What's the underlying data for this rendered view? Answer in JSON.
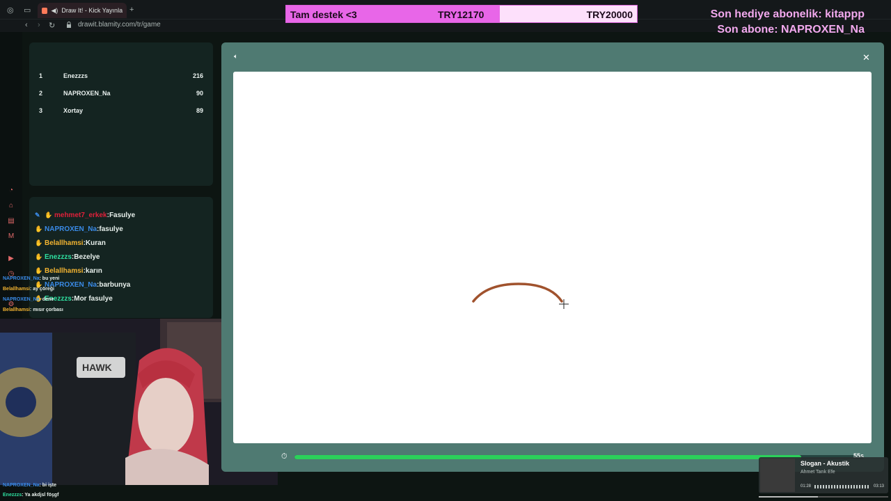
{
  "browser": {
    "tab_title": "Draw It! - Kick Yayınları",
    "url": "drawit.blamity.com/tr/game"
  },
  "leaderboard": [
    {
      "rank": "1",
      "name": "Enezzzs",
      "points": "216"
    },
    {
      "rank": "2",
      "name": "NAPROXEN_Na",
      "points": "90"
    },
    {
      "rank": "3",
      "name": "Xortay",
      "points": "89"
    }
  ],
  "guesses": [
    {
      "user": "mehmet7_erkek",
      "text": ":Fasulye",
      "color": "#e0203a"
    },
    {
      "user": "NAPROXEN_Na",
      "text": ":fasulye",
      "color": "#3a8be8"
    },
    {
      "user": "Belallhamsi",
      "text": ":Kuran",
      "color": "#f3b431"
    },
    {
      "user": "Enezzzs",
      "text": ":Bezelye",
      "color": "#2ee0a0"
    },
    {
      "user": "Belallhamsi",
      "text": ":karın",
      "color": "#f3b431"
    },
    {
      "user": "NAPROXEN_Na",
      "text": ":barbunya",
      "color": "#3a8be8"
    },
    {
      "user": "Enezzzs",
      "text": ":Mor fasulye",
      "color": "#2ee0a0"
    }
  ],
  "chat": [
    {
      "user": "NAPROXEN_Na",
      "text": ": bu yeni",
      "color": "#3a8be8"
    },
    {
      "user": "Belallhamsi",
      "text": ": ay çöreği",
      "color": "#f3b431"
    },
    {
      "user": "NAPROXEN_Na",
      "text": ": dene",
      "color": "#3a8be8"
    },
    {
      "user": "Belallhamsi",
      "text": ": mısır çorbası",
      "color": "#f3b431"
    }
  ],
  "bottom_chat": [
    {
      "user": "NAPROXEN_Na",
      "text": ": bi işte",
      "color": "#3a8be8"
    },
    {
      "user": "Enezzzs",
      "text": ": Ya akdjsl föşgf",
      "color": "#2ee0a0"
    }
  ],
  "goal": {
    "label": "Tam destek <3",
    "current": "TRY12170",
    "target": "TRY20000",
    "progress": 0.6085
  },
  "alerts": {
    "gift_sub": "Son hediye abonelik: kitappp",
    "last_sub": "Son abone: NAPROXEN_Na"
  },
  "game": {
    "timer_progress": 0.89,
    "time_left": "55s",
    "stroke_color": "#a0522d"
  },
  "music": {
    "title": "Slogan - Akustik",
    "artist": "Ahmet Tarık Efe",
    "elapsed": "01:28",
    "duration": "03:13",
    "progress": 0.456
  },
  "webcam": {
    "logo_text": "HAWK"
  }
}
